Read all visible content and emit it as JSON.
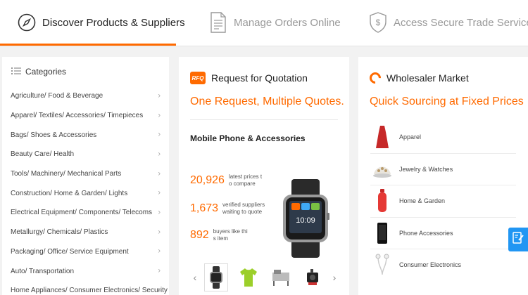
{
  "tabs": [
    {
      "label": "Discover Products & Suppliers",
      "icon": "compass-icon",
      "active": true
    },
    {
      "label": "Manage Orders Online",
      "icon": "document-icon",
      "active": false
    },
    {
      "label": "Access Secure Trade Services",
      "icon": "shield-dollar-icon",
      "active": false
    }
  ],
  "categories": {
    "title": "Categories",
    "items": [
      "Agriculture/ Food & Beverage",
      "Apparel/ Textiles/ Accessories/ Timepieces",
      "Bags/ Shoes & Accessories",
      "Beauty Care/ Health",
      "Tools/ Machinery/ Mechanical Parts",
      "Construction/ Home & Garden/ Lights",
      "Electrical Equipment/ Components/ Telecoms",
      "Metallurgy/ Chemicals/ Plastics",
      "Packaging/ Office/ Service Equipment",
      "Auto/ Transportation",
      "Home Appliances/ Consumer Electronics/ Security"
    ]
  },
  "rfq": {
    "badge": "RFQ",
    "title": "Request for Quotation",
    "slogan": "One Request, Multiple Quotes.",
    "product_title": "Mobile Phone & Accessories",
    "stats": [
      {
        "num": "20,926",
        "desc1": "latest prices t",
        "desc2": "o compare"
      },
      {
        "num": "1,673",
        "desc1": "verified suppliers",
        "desc2": "waiting to quote"
      },
      {
        "num": "892",
        "desc1": "buyers like thi",
        "desc2": "s item"
      }
    ],
    "prev": "‹",
    "next": "›"
  },
  "wholesaler": {
    "title": "Wholesaler Market",
    "slogan": "Quick Sourcing at Fixed Prices",
    "items": [
      "Apparel",
      "Jewelry & Watches",
      "Home & Garden",
      "Phone Accessories",
      "Consumer Electronics"
    ]
  },
  "colors": {
    "accent": "#ff6a00",
    "help": "#2196f3"
  }
}
